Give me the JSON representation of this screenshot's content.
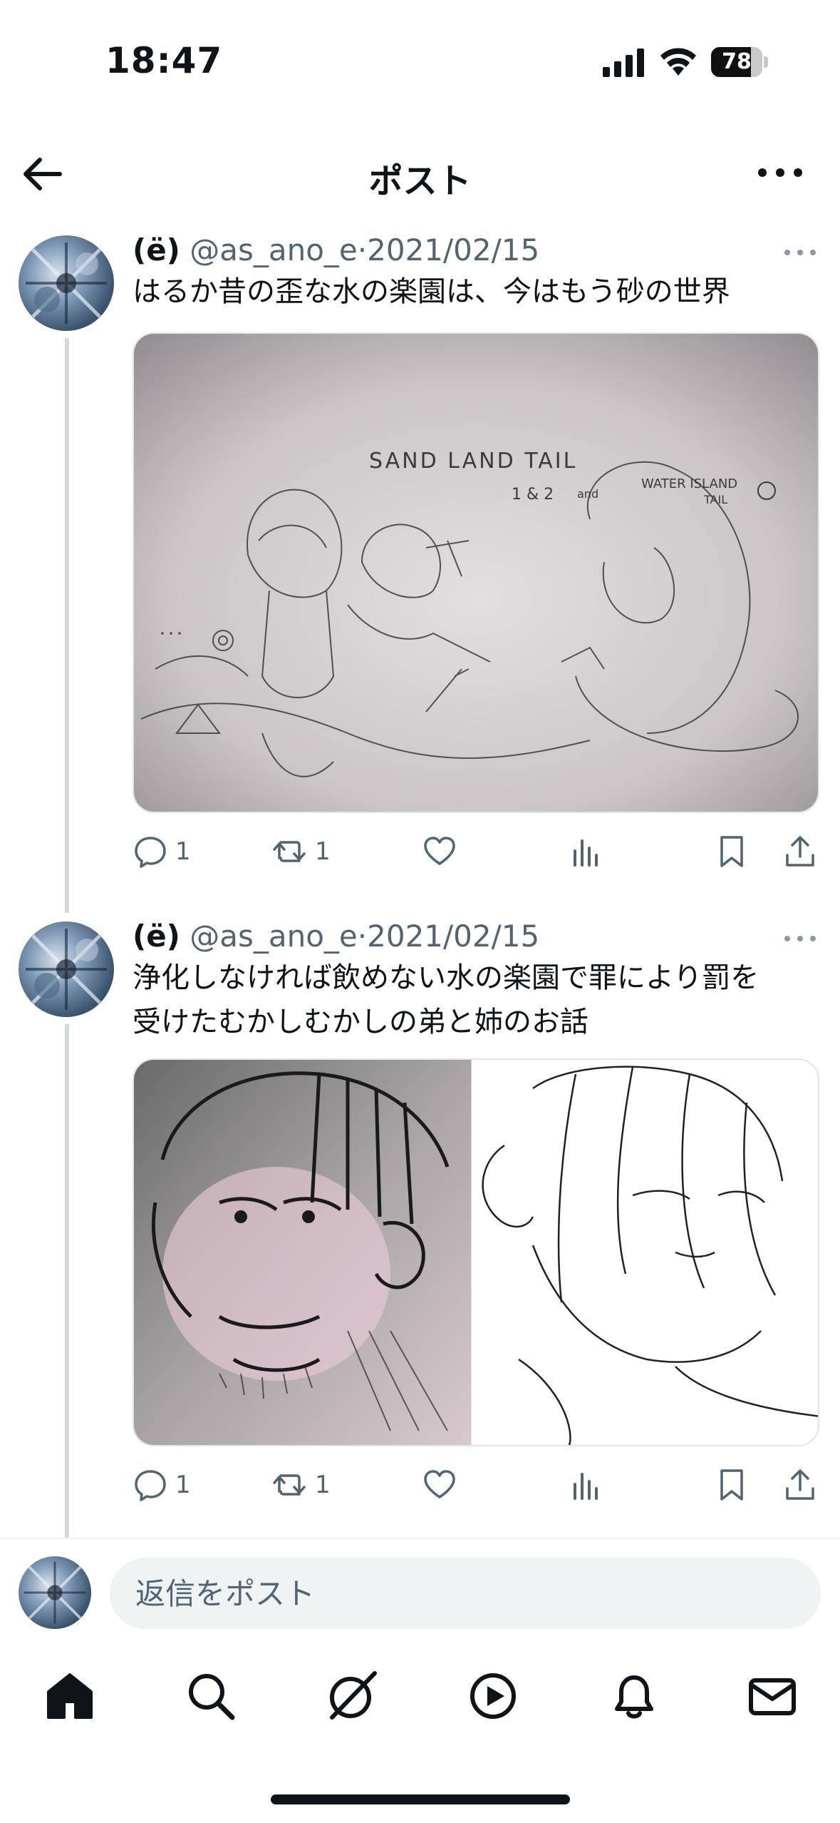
{
  "status_bar": {
    "time": "18:47",
    "battery_level": "78"
  },
  "header": {
    "title": "ポスト",
    "back_icon": "arrow-left-icon",
    "more_icon": "more-horizontal-icon"
  },
  "posts": [
    {
      "display_name": "(ë)",
      "handle": "@as_ano_e",
      "separator": "·",
      "date": "2021/02/15",
      "text": "はるか昔の歪な水の楽園は、今はもう砂の世界",
      "media_caption": {
        "title": "SAND LAND TAIL",
        "subtitle": "1 & 2",
        "and": "and",
        "extra": "WATER ISLAND",
        "extra2": "TAIL"
      },
      "replies": "1",
      "reposts": "1",
      "likes": "",
      "views": ""
    },
    {
      "display_name": "(ë)",
      "handle": "@as_ano_e",
      "separator": "·",
      "date": "2021/02/15",
      "text_line1": "浄化しなければ飲めない水の楽園で罪により罰を",
      "text_line2": "受けたむかしむかしの弟と姉のお話",
      "replies": "1",
      "reposts": "1",
      "likes": "",
      "views": ""
    }
  ],
  "reply_bar": {
    "placeholder": "返信をポスト"
  },
  "bottom_nav": [
    {
      "icon": "home-icon"
    },
    {
      "icon": "search-icon"
    },
    {
      "icon": "grok-icon"
    },
    {
      "icon": "video-play-icon"
    },
    {
      "icon": "notification-bell-icon"
    },
    {
      "icon": "mail-icon"
    }
  ],
  "colors": {
    "text_primary": "#0f1419",
    "text_secondary": "#536471",
    "thread_line": "#cfd9de",
    "input_bg": "#eff3f4"
  }
}
